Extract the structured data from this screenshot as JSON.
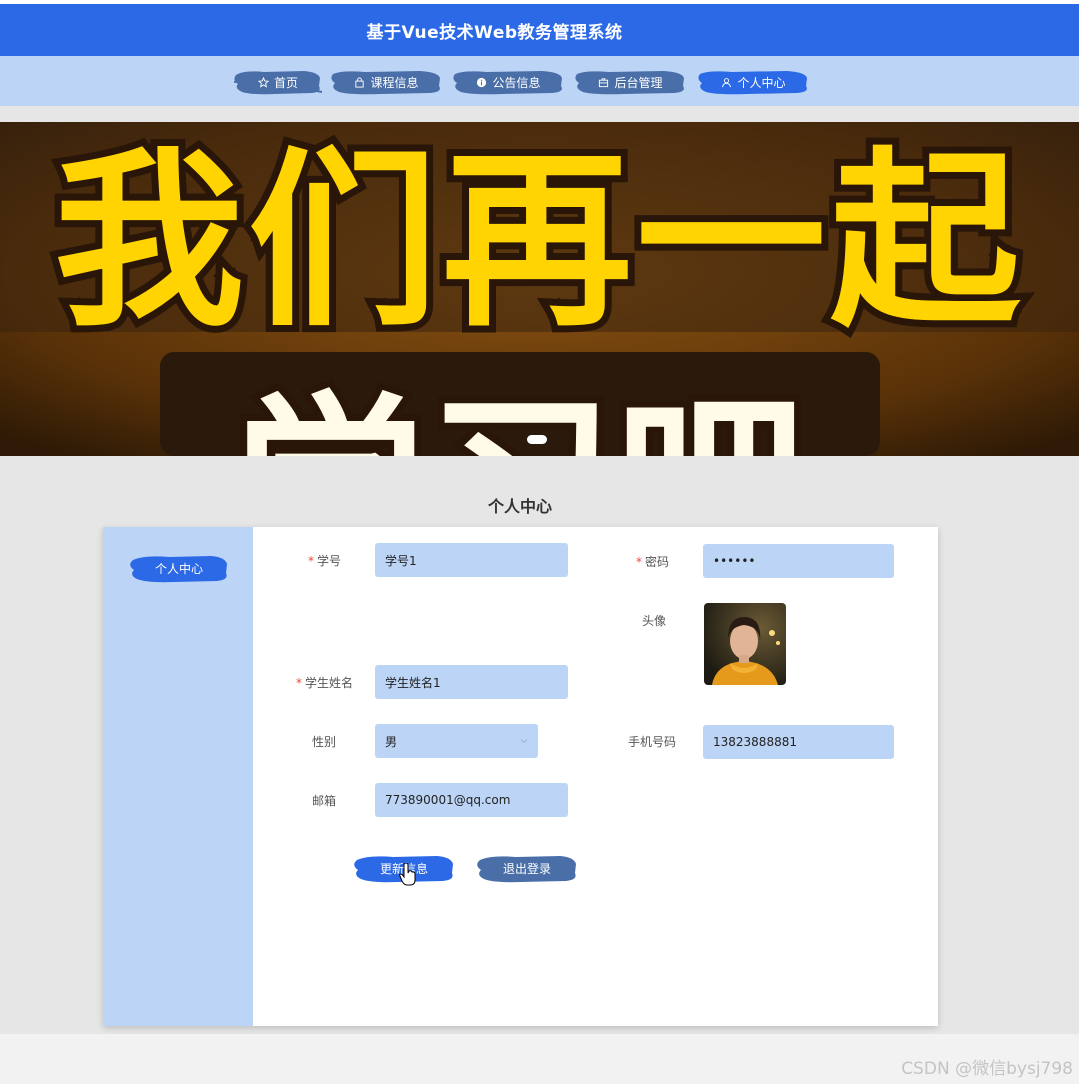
{
  "header": {
    "title": "基于Vue技术Web教务管理系统"
  },
  "nav": {
    "items": [
      {
        "label": "首页",
        "icon": "star-icon",
        "color": "#4a6fa8"
      },
      {
        "label": "课程信息",
        "icon": "bag-icon",
        "color": "#4a6fa8"
      },
      {
        "label": "公告信息",
        "icon": "info-icon",
        "color": "#4a6fa8"
      },
      {
        "label": "后台管理",
        "icon": "briefcase-icon",
        "color": "#4a6fa8"
      },
      {
        "label": "个人中心",
        "icon": "user-icon",
        "color": "#2b69e6"
      }
    ]
  },
  "banner": {
    "line1": "我们再一起",
    "line2": "学习吧"
  },
  "page": {
    "title": "个人中心"
  },
  "sidebar": {
    "items": [
      {
        "label": "个人中心"
      }
    ]
  },
  "form": {
    "student_id": {
      "label": "学号",
      "value": "学号1",
      "required": true
    },
    "password": {
      "label": "密码",
      "value": "••••••",
      "required": true
    },
    "avatar": {
      "label": "头像"
    },
    "student_name": {
      "label": "学生姓名",
      "value": "学生姓名1",
      "required": true
    },
    "gender": {
      "label": "性别",
      "value": "男"
    },
    "phone": {
      "label": "手机号码",
      "value": "13823888881"
    },
    "email": {
      "label": "邮箱",
      "value": "773890001@qq.com"
    },
    "required_mark": "*"
  },
  "buttons": {
    "update": "更新信息",
    "logout": "退出登录"
  },
  "colors": {
    "primary": "#2b69e6",
    "light": "#bcd4f6",
    "nav_brush": "#4a6fa8"
  },
  "watermark": "CSDN @微信bysj798"
}
